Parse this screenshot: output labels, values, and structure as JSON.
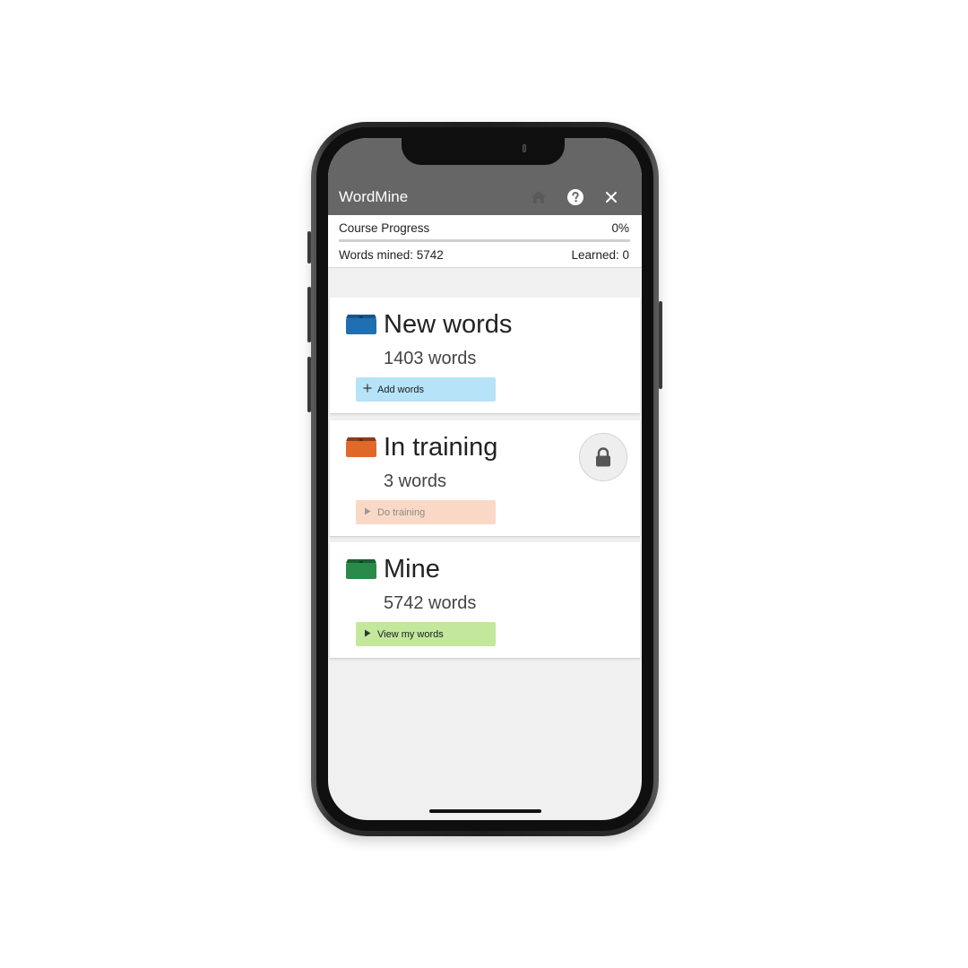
{
  "app": {
    "title": "WordMine",
    "icons": {
      "home": "home-icon",
      "help": "help-icon",
      "close": "close-icon"
    }
  },
  "progress": {
    "label": "Course Progress",
    "percent_text": "0%",
    "percent_value": 0,
    "words_mined": "Words mined: 5742",
    "learned": "Learned: 0"
  },
  "cards": [
    {
      "title": "New words",
      "count": "1403 words",
      "button_label": "Add words",
      "button_icon": "plus-icon",
      "tray_color": "#1f6fb2",
      "button_color": "#b6e3f7"
    },
    {
      "title": "In training",
      "count": "3 words",
      "button_label": "Do training",
      "button_icon": "play-icon",
      "tray_color": "#e0692a",
      "button_color": "#f9d9c6",
      "locked": true,
      "lock_icon": "lock-icon"
    },
    {
      "title": "Mine",
      "count": "5742 words",
      "button_label": "View my words",
      "button_icon": "play-icon",
      "tray_color": "#2a8a4a",
      "button_color": "#c3e89c"
    }
  ]
}
